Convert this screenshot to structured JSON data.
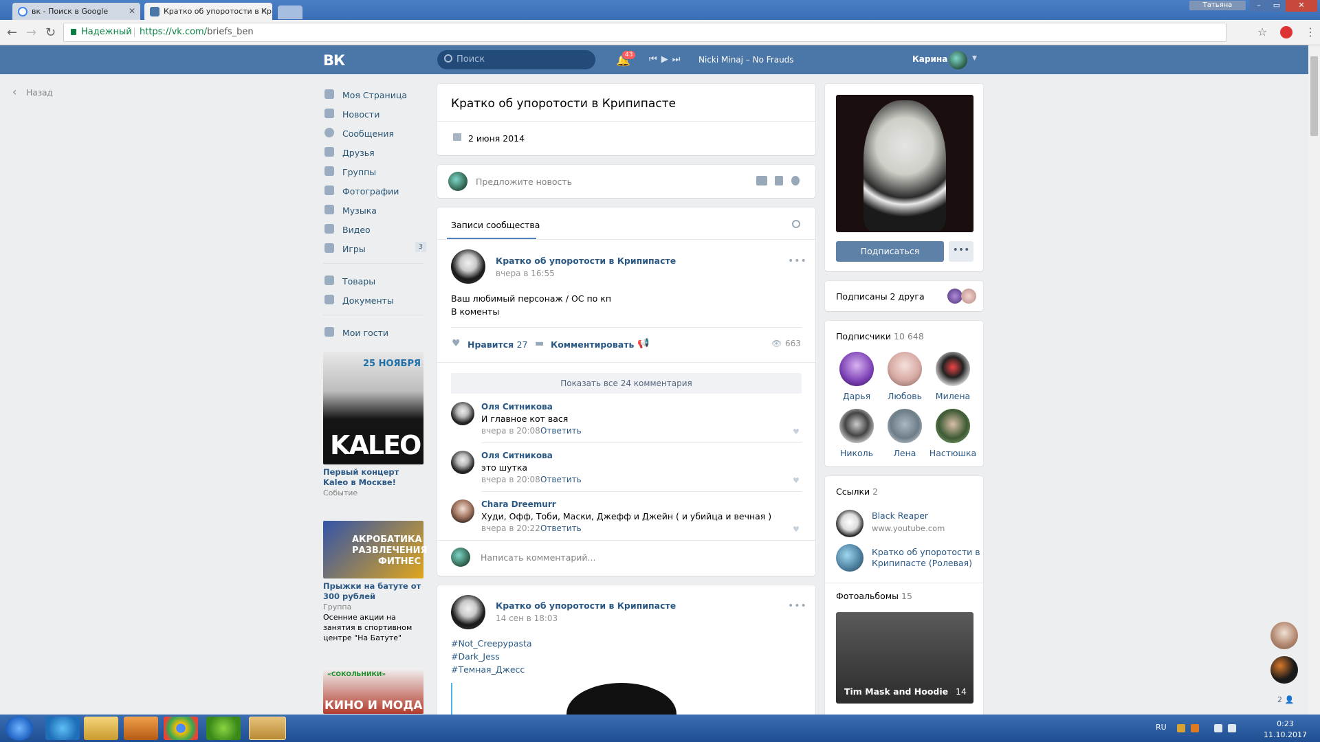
{
  "browser": {
    "tabs": [
      {
        "title": "вк - Поиск в Google"
      },
      {
        "title": "Кратко об упоротости в Крипипасте"
      }
    ],
    "window_user": "Татьяна",
    "secure_label": "Надежный",
    "url_scheme_host": "https://vk.com/",
    "url_path": "briefs_ben"
  },
  "header": {
    "logo": "ВК",
    "search_placeholder": "Поиск",
    "notifications_count": "43",
    "track": "Nicki Minaj – No Frauds",
    "username": "Карина"
  },
  "nav": {
    "back": "Назад",
    "items": [
      {
        "label": "Моя Страница"
      },
      {
        "label": "Новости"
      },
      {
        "label": "Сообщения"
      },
      {
        "label": "Друзья"
      },
      {
        "label": "Группы"
      },
      {
        "label": "Фотографии"
      },
      {
        "label": "Музыка"
      },
      {
        "label": "Видео"
      },
      {
        "label": "Игры",
        "badge": "3"
      },
      {
        "label": "Товары"
      },
      {
        "label": "Документы"
      },
      {
        "label": "Мои гости"
      }
    ]
  },
  "ads": [
    {
      "title": "Первый концерт Kaleo в Москве!",
      "sub": "Событие",
      "img_text": "KALEO",
      "img_badge": "25 НОЯБРЯ"
    },
    {
      "title": "Прыжки на батуте от 300 рублей",
      "sub": "Группа",
      "text": "Осенние акции на занятия в спортивном центре \"На Батуте\"",
      "img_text": "АКРОБАТИКА РАЗВЛЕЧЕНИЯ ФИТНЕС"
    },
    {
      "img_text": "КИНО И МОДА",
      "img_badge": "«СОКОЛЬНИКИ»"
    }
  ],
  "page": {
    "title": "Кратко об упоротости в Крипипасте",
    "date": "2 июня 2014",
    "suggest_placeholder": "Предложите новость",
    "wall_tab": "Записи сообщества"
  },
  "post1": {
    "author": "Кратко об упоротости в Крипипасте",
    "time": "вчера в 16:55",
    "text_line1": "Ваш любимый персонаж / ОС по кп",
    "text_line2": "В коменты",
    "like_label": "Нравится",
    "likes": "27",
    "comment_label": "Комментировать",
    "views": "663",
    "show_all": "Показать все 24 комментария",
    "comments": [
      {
        "name": "Оля Ситникова",
        "text": "И главное кот вася",
        "time": "вчера в 20:08",
        "reply": "Ответить"
      },
      {
        "name": "Оля Ситникова",
        "text": "это шутка",
        "time": "вчера в 20:08",
        "reply": "Ответить"
      },
      {
        "name": "Chara Dreemurr",
        "text": "Худи, Офф, Тоби, Маски, Джефф и Джейн ( и убийца и вечная )",
        "time": "вчера в 20:22",
        "reply": "Ответить"
      }
    ],
    "write_comment": "Написать комментарий..."
  },
  "post2": {
    "author": "Кратко об упоротости в Крипипасте",
    "time": "14 сен в 18:03",
    "tags": [
      "#Not_Creepypasta",
      "#Dark_Jess",
      "#Темная_Джесс"
    ]
  },
  "sidebar": {
    "subscribe": "Подписаться",
    "friends_text": "Подписаны 2 друга",
    "subscribers_label": "Подписчики",
    "subscribers_count": "10 648",
    "subscribers": [
      {
        "name": "Дарья"
      },
      {
        "name": "Любовь"
      },
      {
        "name": "Милена"
      },
      {
        "name": "Николь"
      },
      {
        "name": "Лена"
      },
      {
        "name": "Настюшка"
      }
    ],
    "links_label": "Ссылки",
    "links_count": "2",
    "links": [
      {
        "name": "Black Reaper",
        "sub": "www.youtube.com"
      },
      {
        "name": "Кратко об упоротости в",
        "name2": "Крипипасте (Ролевая)"
      }
    ],
    "albums_label": "Фотоальбомы",
    "albums_count": "15",
    "album": {
      "name": "Tim Mask and Hoodie",
      "count": "14"
    }
  },
  "chat_count": "2",
  "taskbar": {
    "lang": "RU",
    "time": "0:23",
    "date": "11.10.2017"
  }
}
